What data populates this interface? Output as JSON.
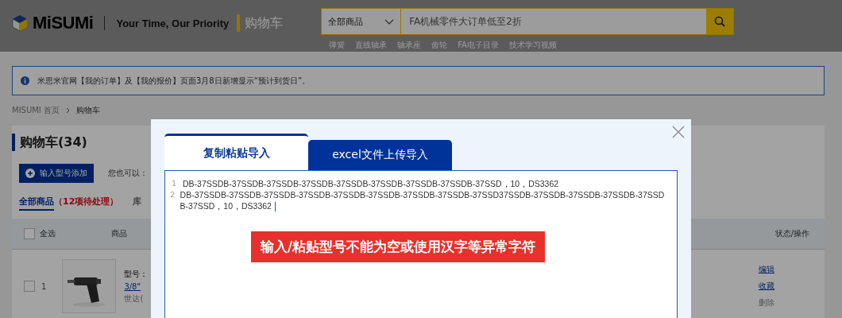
{
  "header": {
    "brand": "MiSUMi",
    "tagline": "Your Time, Our Priority",
    "page_title": "购物车",
    "search": {
      "category": "全部商品",
      "value": "FA机械零件大订单低至2折"
    },
    "quick_links": [
      "弹簧",
      "直线轴承",
      "轴承座",
      "齿轮",
      "FA电子目录",
      "技术学习视频"
    ]
  },
  "notice": "米思米官网【我的订单】及【我的报价】页面3月8日新增显示“预计到货日”。",
  "breadcrumb": [
    "MISUMI 首页",
    "购物车"
  ],
  "cart": {
    "title": "购物车(34)",
    "add_button": "输入型号添加",
    "also_label": "您也可以：",
    "tabs": [
      {
        "label": "全部商品",
        "note": "（12项待处理）",
        "selected": true
      },
      {
        "label": "库",
        "selected": false
      }
    ],
    "select_all": {
      "label": "全选",
      "checked": false
    },
    "columns": [
      "商品",
      "状态/操作"
    ],
    "rows": [
      {
        "index": "1",
        "checked": false,
        "model_label": "型号：",
        "name": "3/8\"",
        "brand": "世达(",
        "actions": [
          {
            "label": "编辑",
            "kind": "link"
          },
          {
            "label": "收藏",
            "kind": "link"
          },
          {
            "label": "删除",
            "kind": "muted"
          }
        ]
      }
    ]
  },
  "dialog": {
    "tabs": [
      {
        "label": "复制粘贴导入",
        "selected": true
      },
      {
        "label": "excel文件上传导入",
        "selected": false
      }
    ],
    "lines": [
      {
        "number": "1",
        "text": "DB-37SSDB-37SSDB-37SSDB-37SSDB-37SSDB-37SSDB-37SSDB-37SSDB-37SSD，10，DS3362"
      },
      {
        "number": "2",
        "text": "DB-37SSDB-37SSDB-37SSDB-37SSDB-37SSDB-37SSDB-37SSDB-37SSDB-37SSD37SSDB-37SSDB-37SSDB-37SSDB-37SSDB-37SSD，10，DS3362"
      }
    ],
    "error": "输入/粘贴型号不能为空或使用汉字等异常字符"
  }
}
